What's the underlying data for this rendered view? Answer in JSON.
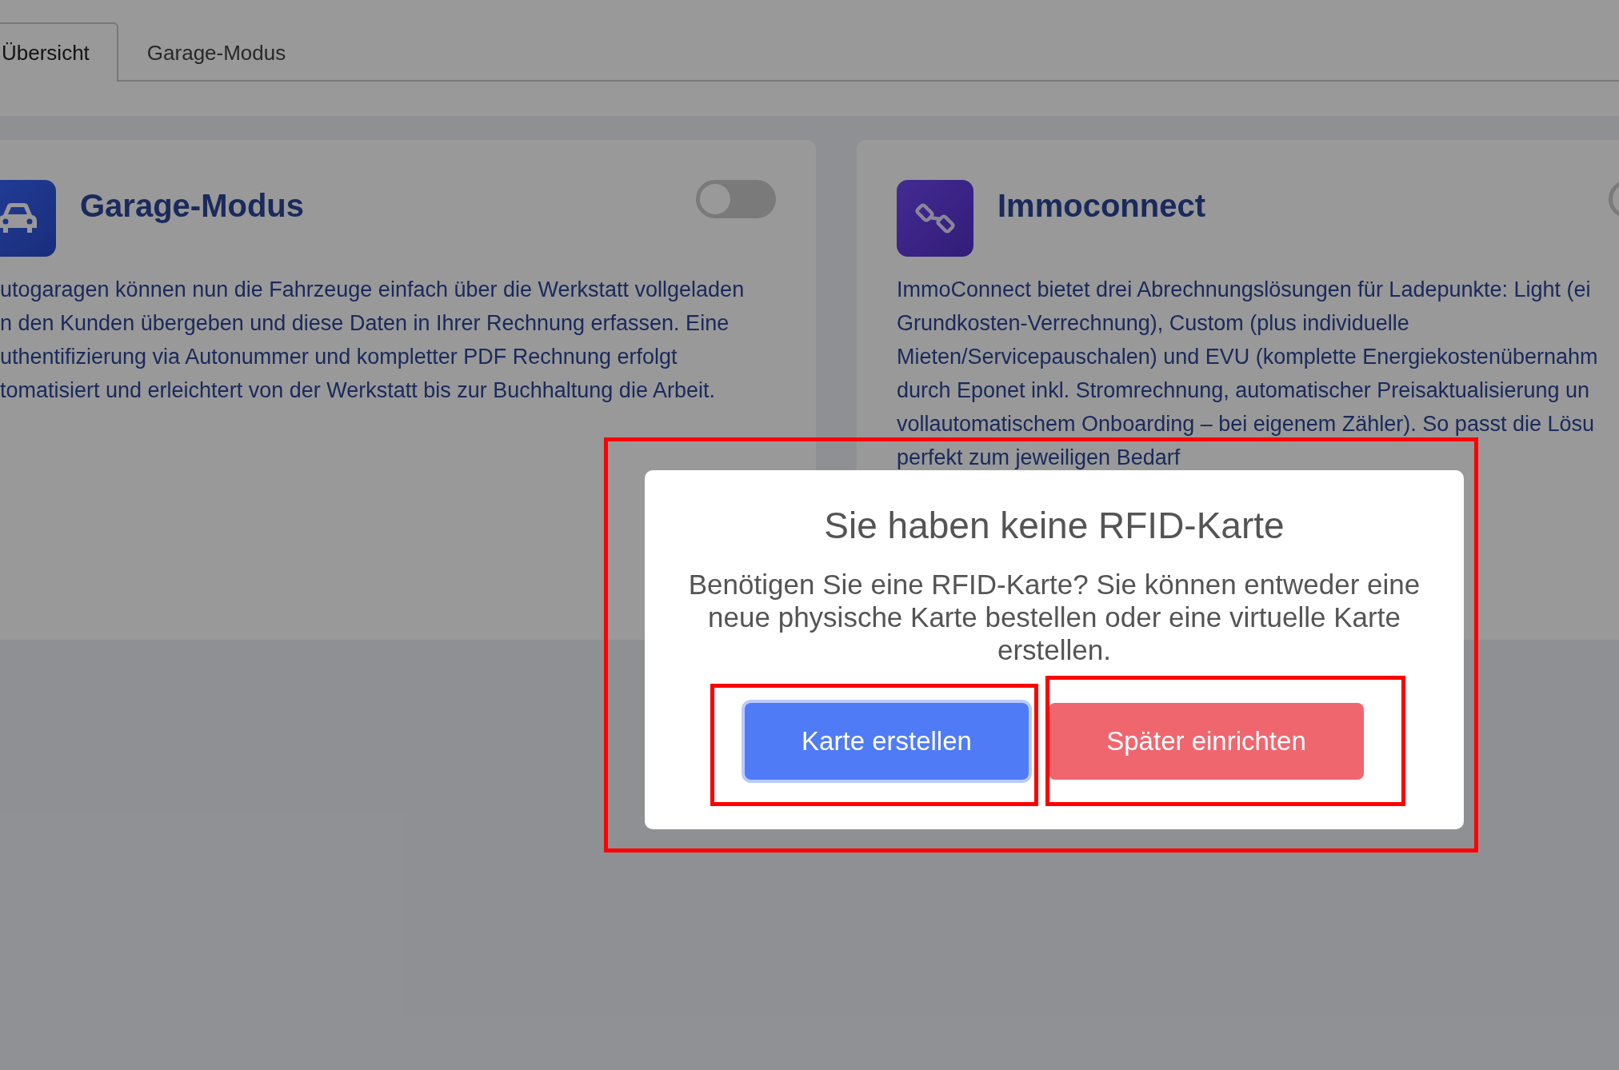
{
  "tabs": [
    {
      "label": "Übersicht",
      "selected": true
    },
    {
      "label": "Garage-Modus",
      "selected": false
    }
  ],
  "cards": [
    {
      "kind": "car",
      "title": "Garage-Modus",
      "toggle": {
        "on": false
      },
      "description_lines": [
        "utogaragen können nun die Fahrzeuge einfach über die Werkstatt vollgeladen",
        "n den Kunden übergeben und diese Daten in Ihrer Rechnung erfassen. Eine",
        "uthentifizierung via Autonummer und kompletter PDF Rechnung erfolgt",
        "tomatisiert und erleichtert von der Werkstatt bis zur Buchhaltung die Arbeit."
      ]
    },
    {
      "kind": "link",
      "title": "Immoconnect",
      "toggle": {
        "on": false
      },
      "description_lines": [
        "ImmoConnect bietet drei Abrechnungslösungen für Ladepunkte: Light (ei",
        "Grundkosten-Verrechnung), Custom (plus individuelle",
        "Mieten/Servicepauschalen) und EVU (komplette Energiekostenübernahm",
        "durch Eponet inkl. Stromrechnung, automatischer Preisaktualisierung un",
        "vollautomatischem Onboarding – bei eigenem Zähler). So passt die Lösu",
        "perfekt zum jeweiligen Bedarf"
      ]
    }
  ],
  "dialog": {
    "title": "Sie haben keine RFID-Karte",
    "message": "Benötigen Sie eine RFID-Karte? Sie können entweder eine neue physische Karte bestellen oder eine virtuelle Karte erstellen.",
    "buttons": [
      {
        "kind": "primary",
        "label": "Karte erstellen",
        "focused": true
      },
      {
        "kind": "danger",
        "label": "Später einrichten",
        "focused": false
      }
    ]
  }
}
